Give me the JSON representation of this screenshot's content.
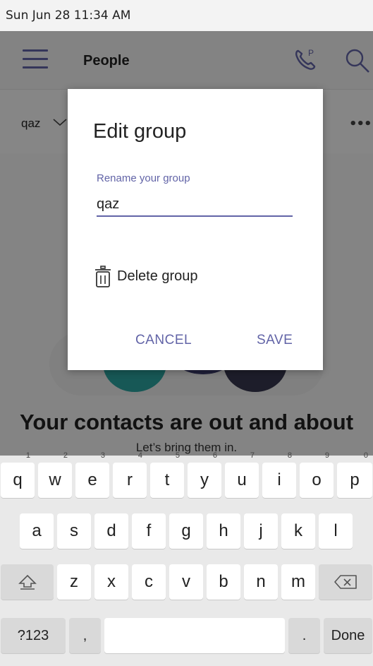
{
  "status": {
    "time": "Sun Jun 28  11:34 AM"
  },
  "appbar": {
    "title": "People",
    "hamburger_icon": "menu-icon",
    "call_icon": "call-park-icon",
    "search_icon": "search-icon"
  },
  "group": {
    "name": "qaz",
    "chevron_icon": "chevron-down-icon",
    "more_label": "•••"
  },
  "empty_state": {
    "title": "Your contacts are out and about",
    "subtitle": "Let’s bring them in."
  },
  "dialog": {
    "title": "Edit group",
    "field_label": "Rename your group",
    "field_value": "qaz",
    "delete_label": "Delete group",
    "cancel_label": "CANCEL",
    "save_label": "SAVE"
  },
  "colors": {
    "accent": "#6264a7",
    "scrim": "#000000"
  },
  "keyboard": {
    "row1": [
      {
        "k": "q",
        "n": "1"
      },
      {
        "k": "w",
        "n": "2"
      },
      {
        "k": "e",
        "n": "3"
      },
      {
        "k": "r",
        "n": "4"
      },
      {
        "k": "t",
        "n": "5"
      },
      {
        "k": "y",
        "n": "6"
      },
      {
        "k": "u",
        "n": "7"
      },
      {
        "k": "i",
        "n": "8"
      },
      {
        "k": "o",
        "n": "9"
      },
      {
        "k": "p",
        "n": "0"
      }
    ],
    "row2": [
      "a",
      "s",
      "d",
      "f",
      "g",
      "h",
      "j",
      "k",
      "l"
    ],
    "row3": [
      "z",
      "x",
      "c",
      "v",
      "b",
      "n",
      "m"
    ],
    "shift_icon": "shift-icon",
    "backspace_icon": "backspace-icon",
    "symbols_label": "?123",
    "comma_label": ",",
    "period_label": ".",
    "done_label": "Done"
  }
}
